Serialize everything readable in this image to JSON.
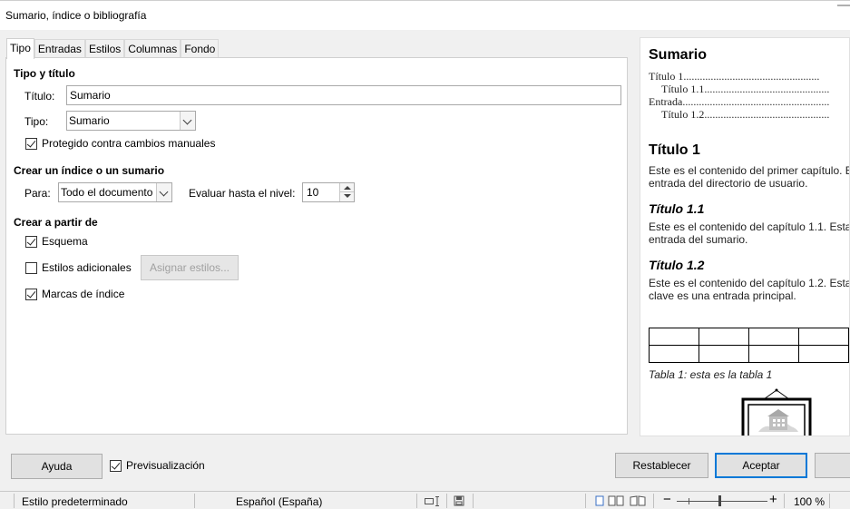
{
  "window": {
    "title": "Sumario, índice o bibliografía"
  },
  "tabs": [
    "Tipo",
    "Entradas",
    "Estilos",
    "Columnas",
    "Fondo"
  ],
  "type_section": {
    "header": "Tipo y título",
    "title_label": "Título:",
    "title_value": "Sumario",
    "type_label": "Tipo:",
    "type_value": "Sumario",
    "protected_label": "Protegido contra cambios manuales",
    "protected_checked": true
  },
  "create_section": {
    "header": "Crear un índice o un sumario",
    "for_label": "Para:",
    "for_value": "Todo el documento",
    "evaluate_label": "Evaluar hasta el nivel:",
    "evaluate_value": "10"
  },
  "from_section": {
    "header": "Crear a partir de",
    "outline_label": "Esquema",
    "outline_checked": true,
    "additional_styles_label": "Estilos adicionales",
    "additional_styles_checked": false,
    "assign_styles_button": "Asignar estilos...",
    "index_marks_label": "Marcas de índice",
    "index_marks_checked": true
  },
  "preview": {
    "heading": "Sumario",
    "toc": [
      {
        "text": "Título 1",
        "dots": ".................................................."
      },
      {
        "text": "Título 1.1",
        "dots": ".............................................."
      },
      {
        "text": "Entrada",
        "dots": "......................................................"
      },
      {
        "text": "Título 1.2",
        "dots": ".............................................."
      }
    ],
    "h1": "Título 1",
    "p1_line1": "Este es el contenido del primer capítulo. Es",
    "p1_line2": "entrada del directorio de usuario.",
    "h11": "Título 1.1",
    "p2_line1": "Este es el contenido del capítulo 1.1. Esta",
    "p2_line2": "entrada del sumario.",
    "h12": "Título 1.2",
    "p3_line1": "Este es el contenido del capítulo 1.2. Esta",
    "p3_line2": "clave es una entrada principal.",
    "caption": "Tabla 1: esta es la tabla 1"
  },
  "footer": {
    "help_button": "Ayuda",
    "preview_label": "Previsualización",
    "preview_checked": true,
    "reset_button": "Restablecer",
    "ok_button": "Aceptar"
  },
  "statusbar": {
    "page_style": "Estilo predeterminado",
    "language": "Español (España)",
    "zoom": "100 %"
  }
}
